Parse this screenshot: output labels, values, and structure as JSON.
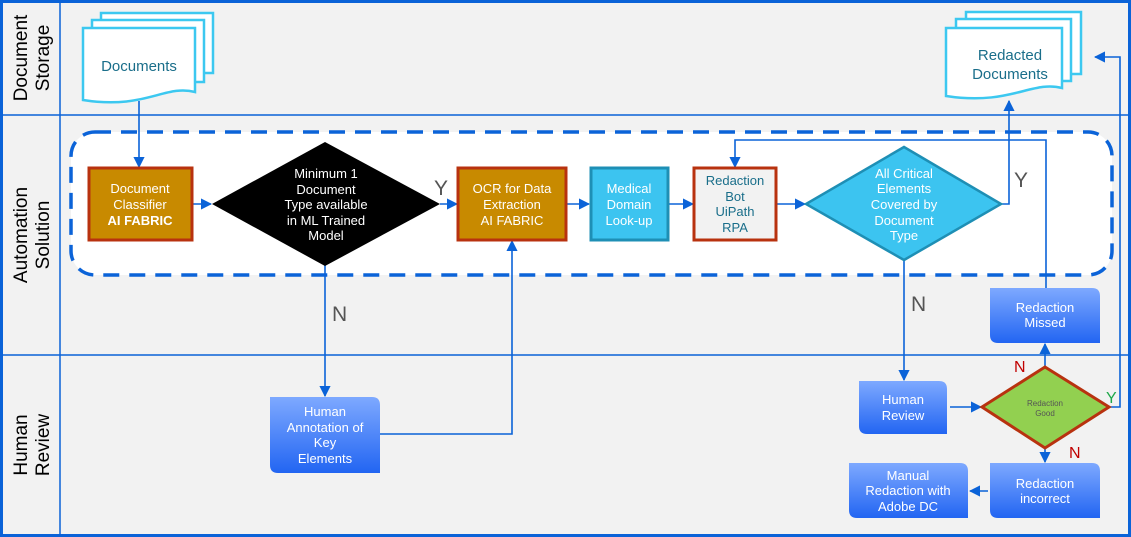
{
  "lanes": [
    {
      "lines": [
        "Document",
        "Storage"
      ]
    },
    {
      "lines": [
        "Automation",
        "Solution"
      ]
    },
    {
      "lines": [
        "Human",
        "Review"
      ]
    }
  ],
  "nodes": {
    "documents": {
      "lines": [
        "Documents"
      ]
    },
    "redacted_documents": {
      "lines": [
        "Redacted",
        "Documents"
      ]
    },
    "document_classifier": {
      "lines": [
        "Document",
        "Classifier",
        "AI FABRIC"
      ]
    },
    "min_doc_type": {
      "lines": [
        "Minimum 1",
        "Document",
        "Type available",
        "in ML Trained",
        "Model"
      ]
    },
    "ocr": {
      "lines": [
        "OCR for Data",
        "Extraction",
        "AI FABRIC"
      ]
    },
    "medical": {
      "lines": [
        "Medical",
        "Domain",
        "Look-up"
      ]
    },
    "redaction_bot": {
      "lines": [
        "Redaction",
        "Bot",
        "UiPath",
        "RPA"
      ]
    },
    "all_critical": {
      "lines": [
        "All Critical",
        "Elements",
        "Covered by",
        "Document",
        "Type"
      ]
    },
    "redaction_missed": {
      "lines": [
        "Redaction",
        "Missed"
      ]
    },
    "human_annotation": {
      "lines": [
        "Human",
        "Annotation of",
        "Key",
        "Elements"
      ]
    },
    "human_review": {
      "lines": [
        "Human",
        "Review"
      ]
    },
    "redaction_good": {
      "lines": [
        "Redaction",
        "Good"
      ]
    },
    "manual_redaction": {
      "lines": [
        "Manual",
        "Redaction with",
        "Adobe DC"
      ]
    },
    "redaction_incorrect": {
      "lines": [
        "Redaction",
        "incorrect"
      ]
    }
  },
  "edge_labels": {
    "y1": "Y",
    "y2": "Y",
    "n1": "N",
    "n2": "N",
    "good_n_up": "N",
    "good_n_down": "N",
    "good_y": "Y"
  },
  "colors": {
    "border": "#0b63d8",
    "ai_fabric": "#c88a00",
    "red_outline": "#b8320f",
    "cyan": "#3cc4f0",
    "green": "#92d050",
    "blue_box": "#3d7ff5"
  }
}
